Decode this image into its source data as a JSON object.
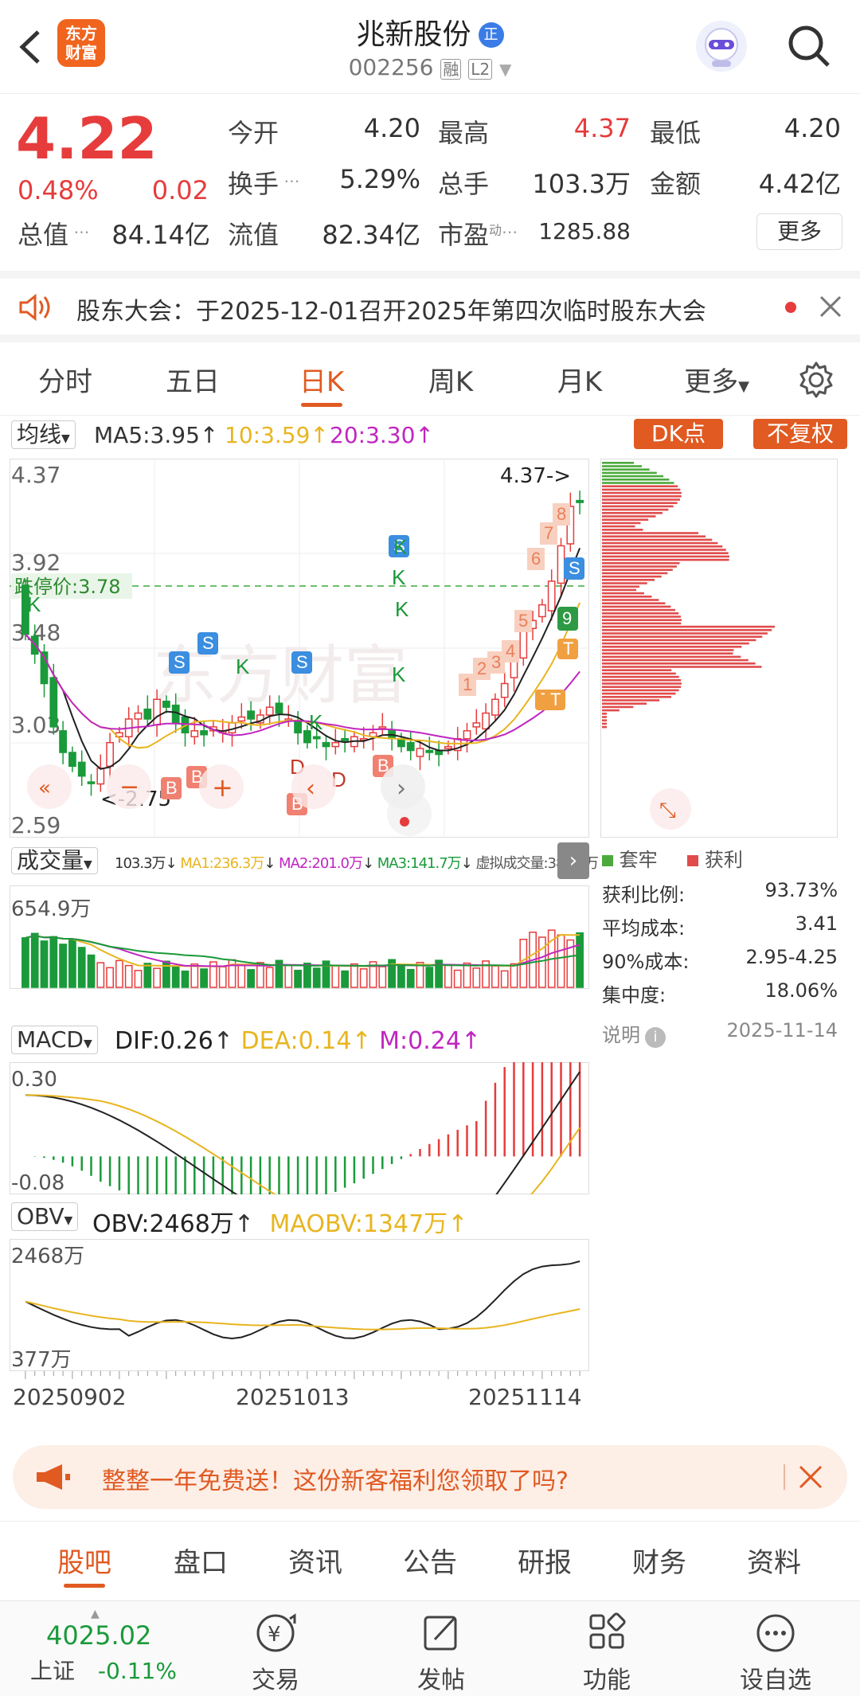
{
  "header": {
    "title": "兆新股份",
    "badge": "正",
    "code": "002256",
    "tag_rong": "融",
    "tag_l2": "L2",
    "logo_text_1": "东方",
    "logo_text_2": "财富"
  },
  "quote": {
    "price": "4.22",
    "change_pct": "0.48%",
    "change": "0.02",
    "open_label": "今开",
    "open": "4.20",
    "high_label": "最高",
    "high": "4.37",
    "low_label": "最低",
    "low": "4.20",
    "turnover_label": "换手",
    "turnover": "5.29%",
    "volume_label": "总手",
    "volume": "103.3万",
    "amount_label": "金额",
    "amount": "4.42亿",
    "mktcap_label": "总值",
    "mktcap": "84.14亿",
    "float_label": "流值",
    "float": "82.34亿",
    "pe_label": "市盈",
    "pe_sup": "动",
    "pe": "1285.88",
    "more_button": "更多"
  },
  "notice": {
    "text": "股东大会：于2025-12-01召开2025年第四次临时股东大会"
  },
  "tabs": [
    "分时",
    "五日",
    "日K",
    "周K",
    "月K",
    "更多"
  ],
  "active_tab": 2,
  "kline": {
    "ma_select": "均线",
    "ma5": "MA5:3.95",
    "ma10": "10:3.59",
    "ma20": "20:3.30",
    "dk_button": "DK点",
    "fuquan_button": "不复权",
    "y_labels": [
      "4.37",
      "3.92",
      "3.48",
      "3.03",
      "2.59"
    ],
    "limit_down": "跌停价:3.78",
    "max_marker": "4.37->",
    "min_marker": "<-2.75",
    "watermark": "东方财富"
  },
  "chip": {
    "legend_trapped": "套牢",
    "legend_profit": "获利",
    "profit_ratio_label": "获利比例:",
    "profit_ratio": "93.73%",
    "avg_cost_label": "平均成本:",
    "avg_cost": "3.41",
    "cost90_label": "90%成本:",
    "cost90": "2.95-4.25",
    "concentration_label": "集中度:",
    "concentration": "18.06%",
    "note_label": "说明",
    "date": "2025-11-14"
  },
  "volume": {
    "select": "成交量",
    "vol": "103.3万",
    "ma1": "MA1:236.3万",
    "ma2": "MA2:201.0万",
    "ma3": "MA3:141.7万",
    "virtual": "虚拟成交量:380.1万",
    "max_label": "654.9万"
  },
  "macd": {
    "select": "MACD",
    "dif": "DIF:0.26",
    "dea": "DEA:0.14",
    "m": "M:0.24",
    "top_label": "0.30",
    "bottom_label": "-0.08"
  },
  "obv": {
    "select": "OBV",
    "obv": "OBV:2468万",
    "maobv": "MAOBV:1347万",
    "top_label": "2468万",
    "bottom_label": "377万"
  },
  "x_dates": [
    "20250902",
    "20251013",
    "20251114"
  ],
  "promo": {
    "text": "整整一年免费送！这份新客福利您领取了吗?"
  },
  "subtabs": [
    "股吧",
    "盘口",
    "资讯",
    "公告",
    "研报",
    "财务",
    "资料"
  ],
  "bottom": {
    "index_value": "4025.02",
    "index_name": "上证",
    "index_change": "-0.11%",
    "trade": "交易",
    "post": "发帖",
    "functions": "功能",
    "watchlist": "设自选"
  },
  "colors": {
    "up": "#e63c3c",
    "down": "#1a9a3a",
    "accent": "#e05a22",
    "ma10": "#e8b520",
    "ma20": "#c026c0"
  },
  "chart_data": {
    "type": "candlestick",
    "closes": [
      3.55,
      3.45,
      3.3,
      3.08,
      2.95,
      2.88,
      2.83,
      2.8,
      2.87,
      3.0,
      3.05,
      3.12,
      3.15,
      3.12,
      3.22,
      3.18,
      3.1,
      3.05,
      3.06,
      3.04,
      3.08,
      3.06,
      3.1,
      3.13,
      3.12,
      3.14,
      3.18,
      3.15,
      3.12,
      3.05,
      3.0,
      3.02,
      2.98,
      3.0,
      3.01,
      3.03,
      3.02,
      3.05,
      3.08,
      3.02,
      2.98,
      2.96,
      2.97,
      2.95,
      2.94,
      2.98,
      3.02,
      3.06,
      3.1,
      3.15,
      3.22,
      3.3,
      3.45,
      3.58,
      3.62,
      3.7,
      3.82,
      4.0,
      4.2,
      4.22
    ]
  }
}
